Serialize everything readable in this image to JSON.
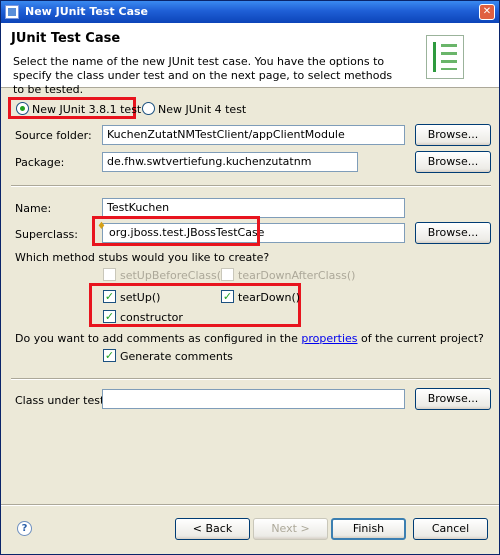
{
  "window": {
    "title": "New JUnit Test Case",
    "close_glyph": "✕"
  },
  "banner": {
    "heading": "JUnit Test Case",
    "description": "Select the name of the new JUnit test case. You have the options to specify the class under test and on the next page, to select methods to be tested.",
    "icon": "junit-wizard-icon"
  },
  "version": {
    "junit3_label": "New JUnit 3.8.1 test",
    "junit4_label": "New JUnit 4 test",
    "selected": "junit3"
  },
  "form": {
    "source_folder_label": "Source folder:",
    "source_folder_value": "KuchenZutatNMTestClient/appClientModule",
    "package_label": "Package:",
    "package_value": "de.fhw.swtvertiefung.kuchenzutatnm",
    "name_label": "Name:",
    "name_value": "TestKuchen",
    "superclass_label": "Superclass:",
    "superclass_value": "org.jboss.test.JBossTestCase",
    "browse_label": "Browse...",
    "class_under_test_label": "Class under test:",
    "class_under_test_value": ""
  },
  "stubs": {
    "question": "Which method stubs would you like to create?",
    "setup_before_class": "setUpBeforeClass()",
    "teardown_after_class": "tearDownAfterClass()",
    "setup": "setUp()",
    "teardown": "tearDown()",
    "constructor": "constructor"
  },
  "comments": {
    "question_before": "Do you want to add comments as configured in the ",
    "question_link": "properties",
    "question_after": " of the current project?",
    "generate_label": "Generate comments"
  },
  "footer": {
    "back_label": "< Back",
    "next_label": "Next >",
    "finish_label": "Finish",
    "cancel_label": "Cancel",
    "help_glyph": "?"
  },
  "colors": {
    "highlight": "#e8141e",
    "title_bar": "#1f5fd6",
    "dialog_bg": "#ece9d8"
  }
}
